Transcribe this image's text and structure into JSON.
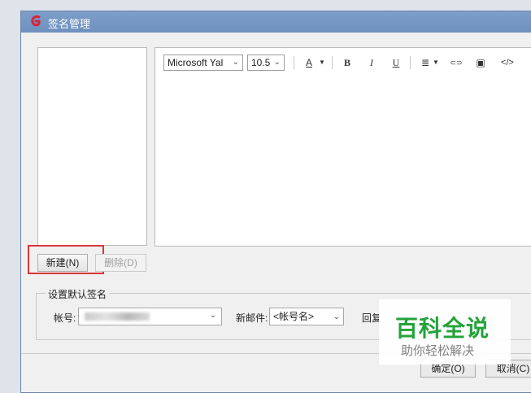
{
  "window": {
    "title": "签名管理",
    "title_icon": "app-logo-icon"
  },
  "toolbar": {
    "font": "Microsoft Yal",
    "size": "10.5",
    "font_color_label": "A",
    "bold": "B",
    "italic": "I",
    "underline": "U",
    "align_icon": "≣",
    "link_icon": "⊂⊃",
    "image_icon": "▣",
    "code_icon": "</>"
  },
  "buttons": {
    "new": "新建(N)",
    "delete": "删除(D)",
    "ok": "确定(O)",
    "cancel": "取消(C)"
  },
  "default_signature": {
    "legend": "设置默认签名",
    "account_label": "帐号:",
    "new_mail_label": "新邮件:",
    "new_mail_value": "<帐号名>",
    "reply_label": "回复"
  },
  "watermark": {
    "main": "百科全说",
    "sub": "助你轻松解决"
  },
  "colors": {
    "title_bar": "#7d9ec8",
    "highlight_border": "#d9353a",
    "watermark_green": "#23a33a"
  }
}
